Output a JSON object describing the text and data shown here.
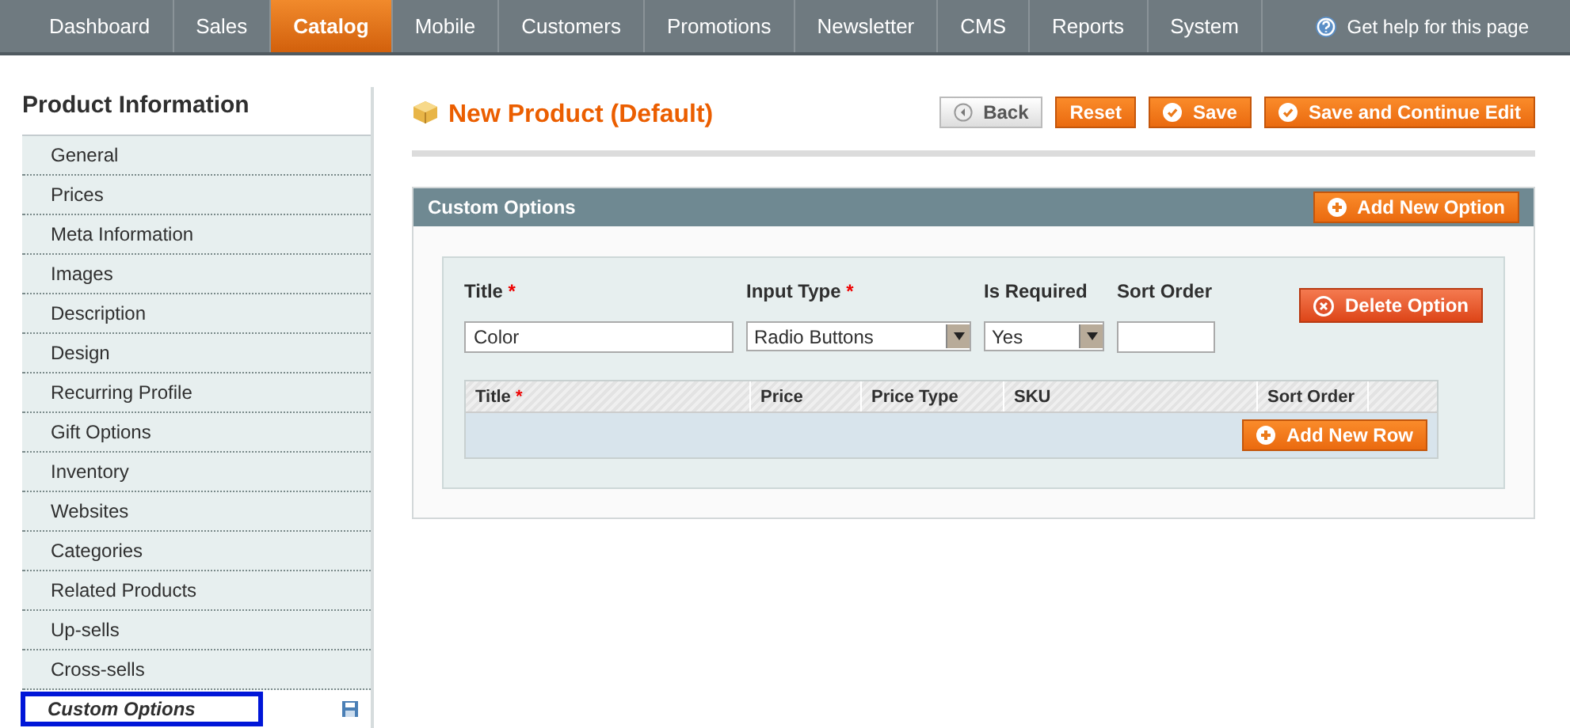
{
  "nav": {
    "items": [
      {
        "label": "Dashboard",
        "selected": false
      },
      {
        "label": "Sales",
        "selected": false
      },
      {
        "label": "Catalog",
        "selected": true
      },
      {
        "label": "Mobile",
        "selected": false
      },
      {
        "label": "Customers",
        "selected": false
      },
      {
        "label": "Promotions",
        "selected": false
      },
      {
        "label": "Newsletter",
        "selected": false
      },
      {
        "label": "CMS",
        "selected": false
      },
      {
        "label": "Reports",
        "selected": false
      },
      {
        "label": "System",
        "selected": false
      }
    ],
    "help": "Get help for this page"
  },
  "sidebar": {
    "title": "Product Information",
    "items": [
      {
        "label": "General",
        "selected": false
      },
      {
        "label": "Prices",
        "selected": false
      },
      {
        "label": "Meta Information",
        "selected": false
      },
      {
        "label": "Images",
        "selected": false
      },
      {
        "label": "Description",
        "selected": false
      },
      {
        "label": "Design",
        "selected": false
      },
      {
        "label": "Recurring Profile",
        "selected": false
      },
      {
        "label": "Gift Options",
        "selected": false
      },
      {
        "label": "Inventory",
        "selected": false
      },
      {
        "label": "Websites",
        "selected": false
      },
      {
        "label": "Categories",
        "selected": false
      },
      {
        "label": "Related Products",
        "selected": false
      },
      {
        "label": "Up-sells",
        "selected": false
      },
      {
        "label": "Cross-sells",
        "selected": false
      },
      {
        "label": "Custom Options",
        "selected": true
      }
    ]
  },
  "page": {
    "title": "New Product (Default)",
    "buttons": [
      {
        "label": "Back",
        "kind": "back"
      },
      {
        "label": "Reset",
        "kind": "plain"
      },
      {
        "label": "Save",
        "kind": "save"
      },
      {
        "label": "Save and Continue Edit",
        "kind": "save"
      }
    ]
  },
  "section": {
    "title": "Custom Options",
    "add_button": "Add New Option",
    "option": {
      "fields": [
        {
          "label": "Title",
          "mark": "*",
          "kind": "text",
          "value": "Color"
        },
        {
          "label": "Input Type",
          "mark": "*",
          "kind": "select",
          "value": "Radio Buttons"
        },
        {
          "label": "Is Required",
          "kind": "select",
          "value": "Yes"
        },
        {
          "label": "Sort Order",
          "kind": "text"
        }
      ],
      "delete_button": "Delete Option",
      "table": {
        "columns": [
          {
            "label": "Title",
            "mark": "*"
          },
          {
            "label": "Price"
          },
          {
            "label": "Price Type"
          },
          {
            "label": "SKU"
          },
          {
            "label": "Sort Order"
          }
        ],
        "add_row_button": "Add New Row"
      }
    }
  }
}
